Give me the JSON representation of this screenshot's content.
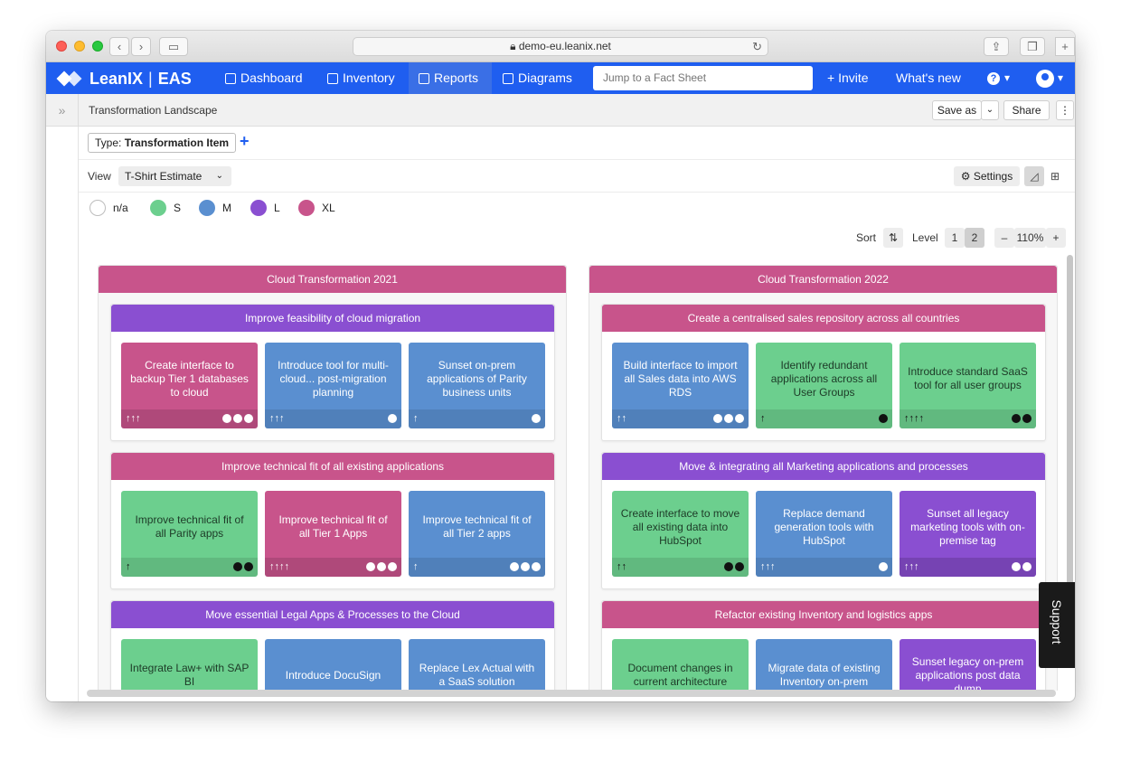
{
  "browser": {
    "url": "demo-eu.leanix.net"
  },
  "navbar": {
    "brand": "LeanIX",
    "workspace": "EAS",
    "items": [
      {
        "label": "Dashboard",
        "icon": "dashboard-icon",
        "active": false
      },
      {
        "label": "Inventory",
        "icon": "inventory-icon",
        "active": false
      },
      {
        "label": "Reports",
        "icon": "reports-icon",
        "active": true
      },
      {
        "label": "Diagrams",
        "icon": "diagrams-icon",
        "active": false
      }
    ],
    "search_placeholder": "Jump to a Fact Sheet",
    "invite": "+ Invite",
    "whats_new": "What's new"
  },
  "report": {
    "title": "Transformation Landscape",
    "save_as": "Save as",
    "share": "Share"
  },
  "filter": {
    "type_label": "Type:",
    "type_value": "Transformation Item"
  },
  "view": {
    "label": "View",
    "selected": "T-Shirt Estimate",
    "settings": "Settings"
  },
  "legend": [
    {
      "label": "n/a",
      "color": "#ffffff"
    },
    {
      "label": "S",
      "color": "#6ccf8e"
    },
    {
      "label": "M",
      "color": "#5a8fd0"
    },
    {
      "label": "L",
      "color": "#8a4fd1"
    },
    {
      "label": "XL",
      "color": "#c8548b"
    }
  ],
  "toolbar": {
    "sort": "Sort",
    "level": "Level",
    "level_options": [
      "1",
      "2"
    ],
    "level_selected": "2",
    "zoom": "110%"
  },
  "support": "Support",
  "columns": [
    {
      "title": "Cloud Transformation 2021",
      "groups": [
        {
          "title": "Improve feasibility of cloud migration",
          "size": "L",
          "cards": [
            {
              "text": "Create interface to backup Tier 1 databases to cloud",
              "size": "XL",
              "arrows": "↑↑↑",
              "minus": 3
            },
            {
              "text": "Introduce tool for multi-cloud... post-migration planning",
              "size": "M",
              "arrows": "↑↑↑",
              "minus": 1
            },
            {
              "text": "Sunset on-prem applications of Parity business units",
              "size": "M",
              "arrows": "↑",
              "minus": 1
            }
          ]
        },
        {
          "title": "Improve technical fit of all existing applications",
          "size": "XL",
          "cards": [
            {
              "text": "Improve technical fit of all Parity apps",
              "size": "S",
              "arrows": "↑",
              "minus": 2
            },
            {
              "text": "Improve technical fit of all Tier 1 Apps",
              "size": "XL",
              "arrows": "↑↑↑↑",
              "minus": 3
            },
            {
              "text": "Improve technical fit of all Tier 2 apps",
              "size": "M",
              "arrows": "↑",
              "minus": 3
            }
          ]
        },
        {
          "title": "Move essential Legal Apps & Processes to the Cloud",
          "size": "L",
          "cards": [
            {
              "text": "Integrate Law+ with SAP BI",
              "size": "S",
              "arrows": "",
              "minus": 0
            },
            {
              "text": "Introduce DocuSign",
              "size": "M",
              "arrows": "",
              "minus": 0
            },
            {
              "text": "Replace Lex Actual with a SaaS solution",
              "size": "M",
              "arrows": "",
              "minus": 0
            }
          ]
        }
      ]
    },
    {
      "title": "Cloud Transformation 2022",
      "groups": [
        {
          "title": "Create a centralised sales repository across all countries",
          "size": "XL",
          "cards": [
            {
              "text": "Build interface to import all Sales data into AWS RDS",
              "size": "M",
              "arrows": "↑↑",
              "minus": 3
            },
            {
              "text": "Identify redundant applications across all User Groups",
              "size": "S",
              "arrows": "↑",
              "minus": 1
            },
            {
              "text": "Introduce standard SaaS tool for all user groups",
              "size": "S",
              "arrows": "↑↑↑↑",
              "minus": 2
            }
          ]
        },
        {
          "title": "Move & integrating all Marketing applications and processes",
          "size": "L",
          "cards": [
            {
              "text": "Create interface to move all existing data into HubSpot",
              "size": "S",
              "arrows": "↑↑",
              "minus": 2
            },
            {
              "text": "Replace demand generation tools with HubSpot",
              "size": "M",
              "arrows": "↑↑↑",
              "minus": 1
            },
            {
              "text": "Sunset all legacy marketing tools with on-premise tag",
              "size": "L",
              "arrows": "↑↑↑",
              "minus": 2
            }
          ]
        },
        {
          "title": "Refactor existing Inventory and logistics apps",
          "size": "XL",
          "cards": [
            {
              "text": "Document changes in current architecture",
              "size": "S",
              "arrows": "",
              "minus": 0
            },
            {
              "text": "Migrate data of existing Inventory on-prem",
              "size": "M",
              "arrows": "",
              "minus": 0
            },
            {
              "text": "Sunset legacy on-prem applications post data dump",
              "size": "L",
              "arrows": "",
              "minus": 0
            }
          ]
        }
      ]
    }
  ]
}
